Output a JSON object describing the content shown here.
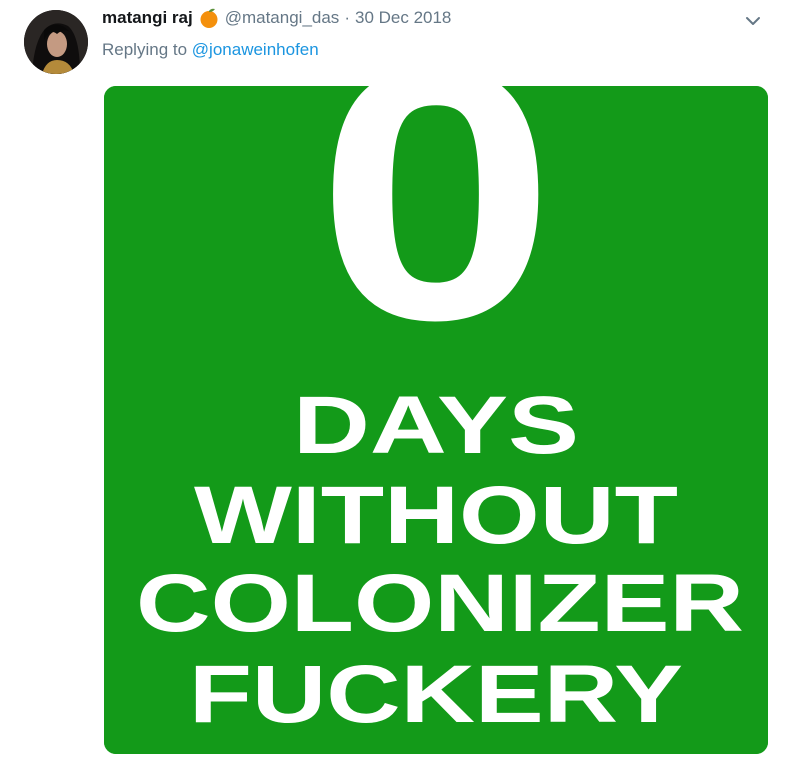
{
  "tweet": {
    "display_name": "matangi raj",
    "handle": "@matangi_das",
    "separator": "·",
    "date": "30 Dec 2018",
    "name_emoji": "orange-emoji",
    "replying_prefix": "Replying to",
    "replying_to": "@jonaweinhofen",
    "menu_icon": "chevron-down-icon"
  },
  "image": {
    "big_number": "0",
    "lines": [
      "DAYS",
      "WITHOUT",
      "COLONIZER",
      "FUCKERY"
    ],
    "background_color": "#139a19",
    "text_color": "#ffffff"
  },
  "colors": {
    "name": "#14171a",
    "meta": "#657786",
    "link": "#1b95e0"
  }
}
